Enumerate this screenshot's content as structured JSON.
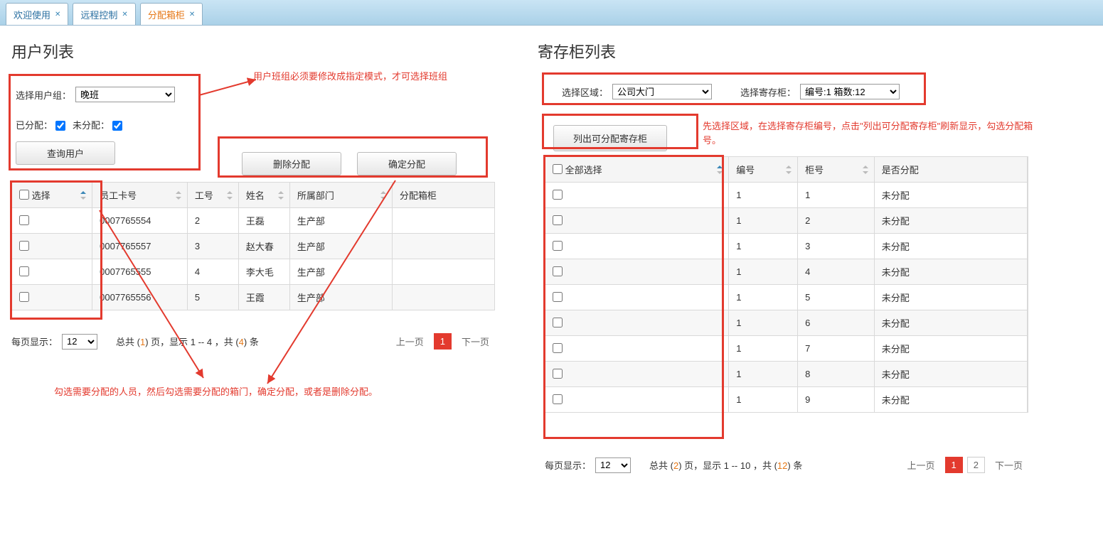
{
  "tabs": [
    {
      "label": "欢迎使用",
      "closable": true,
      "active": false
    },
    {
      "label": "远程控制",
      "closable": true,
      "active": false
    },
    {
      "label": "分配箱柜",
      "closable": true,
      "active": true
    }
  ],
  "left": {
    "title": "用户列表",
    "annotation_top": "用户班组必须要修改成指定模式，才可选择班组",
    "filter": {
      "group_label": "选择用户组：",
      "group_value": "晚班",
      "assigned_label": "已分配：",
      "unassigned_label": "未分配：",
      "query_btn": "查询用户"
    },
    "actions": {
      "delete_btn": "删除分配",
      "confirm_btn": "确定分配"
    },
    "columns": {
      "select": "选择",
      "card": "员工卡号",
      "workno": "工号",
      "name": "姓名",
      "dept": "所属部门",
      "locker": "分配箱柜"
    },
    "rows": [
      {
        "card": "0007765554",
        "workno": "2",
        "name": "王磊",
        "dept": "生产部",
        "locker": ""
      },
      {
        "card": "0007765557",
        "workno": "3",
        "name": "赵大春",
        "dept": "生产部",
        "locker": ""
      },
      {
        "card": "0007765555",
        "workno": "4",
        "name": "李大毛",
        "dept": "生产部",
        "locker": ""
      },
      {
        "card": "0007765556",
        "workno": "5",
        "name": "王霞",
        "dept": "生产部",
        "locker": ""
      }
    ],
    "pager": {
      "per_page_label": "每页显示：",
      "per_page_value": "12",
      "summary_prefix": "总共 (",
      "total_pages": "1",
      "summary_mid1": ") 页，显示 ",
      "range": "1 -- 4",
      "summary_mid2": " ，共 (",
      "total_rows": "4",
      "summary_suffix": ") 条",
      "prev": "上一页",
      "pages": [
        "1"
      ],
      "next": "下一页",
      "current": "1"
    },
    "annotation_bottom": "勾选需要分配的人员，然后勾选需要分配的箱门，确定分配，或者是删除分配。"
  },
  "right": {
    "title": "寄存柜列表",
    "filter": {
      "area_label": "选择区域：",
      "area_value": "公司大门",
      "locker_label": "选择寄存柜：",
      "locker_value": "编号:1 箱数:12"
    },
    "list_btn": "列出可分配寄存柜",
    "annotation_right": "先选择区域，在选择寄存柜编号，点击\"列出可分配寄存柜\"刷新显示，勾选分配箱号。",
    "columns": {
      "select_all": "全部选择",
      "serial": "编号",
      "box": "柜号",
      "assigned": "是否分配"
    },
    "rows": [
      {
        "serial": "1",
        "box": "1",
        "assigned": "未分配"
      },
      {
        "serial": "1",
        "box": "2",
        "assigned": "未分配"
      },
      {
        "serial": "1",
        "box": "3",
        "assigned": "未分配"
      },
      {
        "serial": "1",
        "box": "4",
        "assigned": "未分配"
      },
      {
        "serial": "1",
        "box": "5",
        "assigned": "未分配"
      },
      {
        "serial": "1",
        "box": "6",
        "assigned": "未分配"
      },
      {
        "serial": "1",
        "box": "7",
        "assigned": "未分配"
      },
      {
        "serial": "1",
        "box": "8",
        "assigned": "未分配"
      },
      {
        "serial": "1",
        "box": "9",
        "assigned": "未分配"
      }
    ],
    "pager": {
      "per_page_label": "每页显示：",
      "per_page_value": "12",
      "summary_prefix": "总共 (",
      "total_pages": "2",
      "summary_mid1": ") 页，显示 ",
      "range": "1 -- 10",
      "summary_mid2": " ，共 (",
      "total_rows": "12",
      "summary_suffix": ") 条",
      "prev": "上一页",
      "pages": [
        "1",
        "2"
      ],
      "next": "下一页",
      "current": "1"
    }
  }
}
